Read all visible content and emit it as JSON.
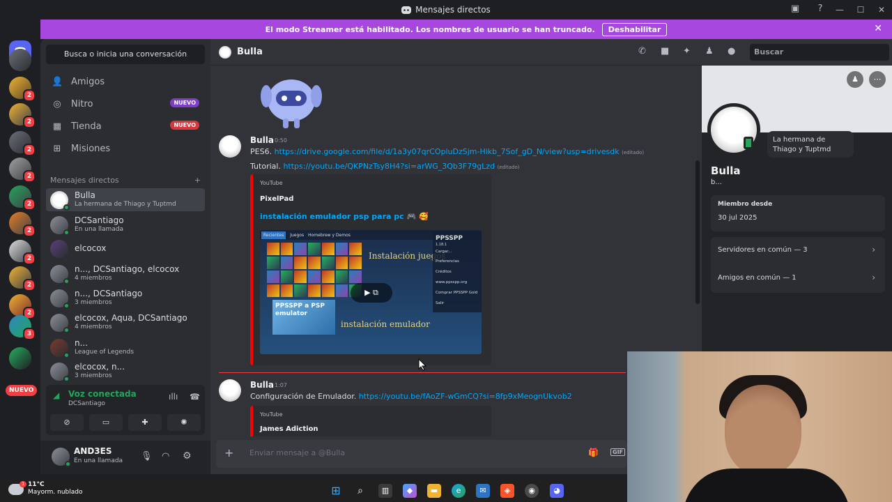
{
  "window": {
    "title": "Mensajes directos",
    "controls": [
      "—",
      "☐",
      "✕"
    ]
  },
  "banner": {
    "text": "El modo Streamer está habilitado. Los nombres de usuario se han truncado.",
    "button": "Deshabilitar"
  },
  "rail": {
    "new_label": "NUEVO",
    "badge": "2",
    "badge_alt": "3"
  },
  "sidebar": {
    "search_placeholder": "Busca o inicia una conversación",
    "nav": [
      {
        "label": "Amigos",
        "icon": "friends-icon"
      },
      {
        "label": "Nitro",
        "icon": "nitro-icon",
        "pill": "NUEVO"
      },
      {
        "label": "Tienda",
        "icon": "shop-icon",
        "pill": "NUEVO"
      },
      {
        "label": "Misiones",
        "icon": "quests-icon"
      }
    ],
    "dm_header": "Mensajes directos",
    "dms": [
      {
        "name": "Bulla",
        "sub": "La hermana de Thiago y Tuptmd"
      },
      {
        "name": "DCSantiago",
        "sub": "En una llamada"
      },
      {
        "name": "elcocox",
        "sub": ""
      },
      {
        "name": "n..., DCSantiago, elcocox",
        "sub": "4 miembros"
      },
      {
        "name": "n..., DCSantiago",
        "sub": "3 miembros"
      },
      {
        "name": "elcocox, Aqua, DCSantiago",
        "sub": "4 miembros"
      },
      {
        "name": "n...",
        "sub": "League of Legends"
      },
      {
        "name": "elcocox, n...",
        "sub": "3 miembros"
      }
    ],
    "voice": {
      "title": "Voz conectada",
      "channel": "DCSantiago"
    },
    "user": {
      "name": "AND3ES",
      "status": "En una llamada"
    }
  },
  "chat": {
    "header_name": "Bulla",
    "search_placeholder": "Buscar",
    "messages": [
      {
        "author": "Bulla",
        "time": "0:50",
        "lines": [
          {
            "prefix": "PES6.",
            "link": "https://drive.google.com/file/d/1a3y07qrCOpluDzSjm-Hikb_7Sof_gD_N/view?usp=drivesdk",
            "edited": "(editado)"
          },
          {
            "prefix": "Tutorial.",
            "link": "https://youtu.be/QKPNzTsy8H4?si=arWG_3Qb3F79gLzd",
            "edited": "(editado)"
          }
        ],
        "embed": {
          "provider": "YouTube",
          "author": "PixelPad",
          "title": "instalación emulador psp para pc 🎮 🥰",
          "thumb": {
            "tabs": [
              "Recientes",
              "Juegos",
              "Homebrew y Demos"
            ],
            "logo_title": "PPSSPP",
            "version": "1.18.1",
            "menu": [
              "Cargar...",
              "Preferencias",
              "Créditos",
              "www.ppsspp.org",
              "Comprar PPSSPP Gold",
              "Salir"
            ],
            "handwriting_1": "Instalación juegos",
            "handwriting_2": "instalación emulador",
            "psp_logo": "PPSSPP a PSP emulator"
          }
        }
      },
      {
        "author": "Bulla",
        "time": "1:07",
        "lines": [
          {
            "prefix": "Configuración de Emulador.",
            "link": "https://youtu.be/fAoZF-wGmCQ?si=8fp9xMeognUkvob2",
            "edited": ""
          }
        ],
        "embed": {
          "provider": "YouTube",
          "author": "James Adiction"
        }
      }
    ],
    "composer_placeholder": "Enviar mensaje a @Bulla"
  },
  "profile": {
    "name": "Bulla",
    "username": "b...",
    "status_bubble": "La hermana de Thiago y Tuptmd",
    "member_since_label": "Miembro desde",
    "member_since": "30 jul 2025",
    "servers_common": "Servidores en común — 3",
    "friends_common": "Amigos en común — 1"
  },
  "taskbar": {
    "temp": "11°C",
    "weather": "Mayorm. nublado",
    "notification_count": "1"
  },
  "colors": {
    "blurple": "#5865f2",
    "streamer_banner": "#a847e0",
    "link": "#00a8fc",
    "online": "#23a55a",
    "danger": "#f23f43"
  }
}
